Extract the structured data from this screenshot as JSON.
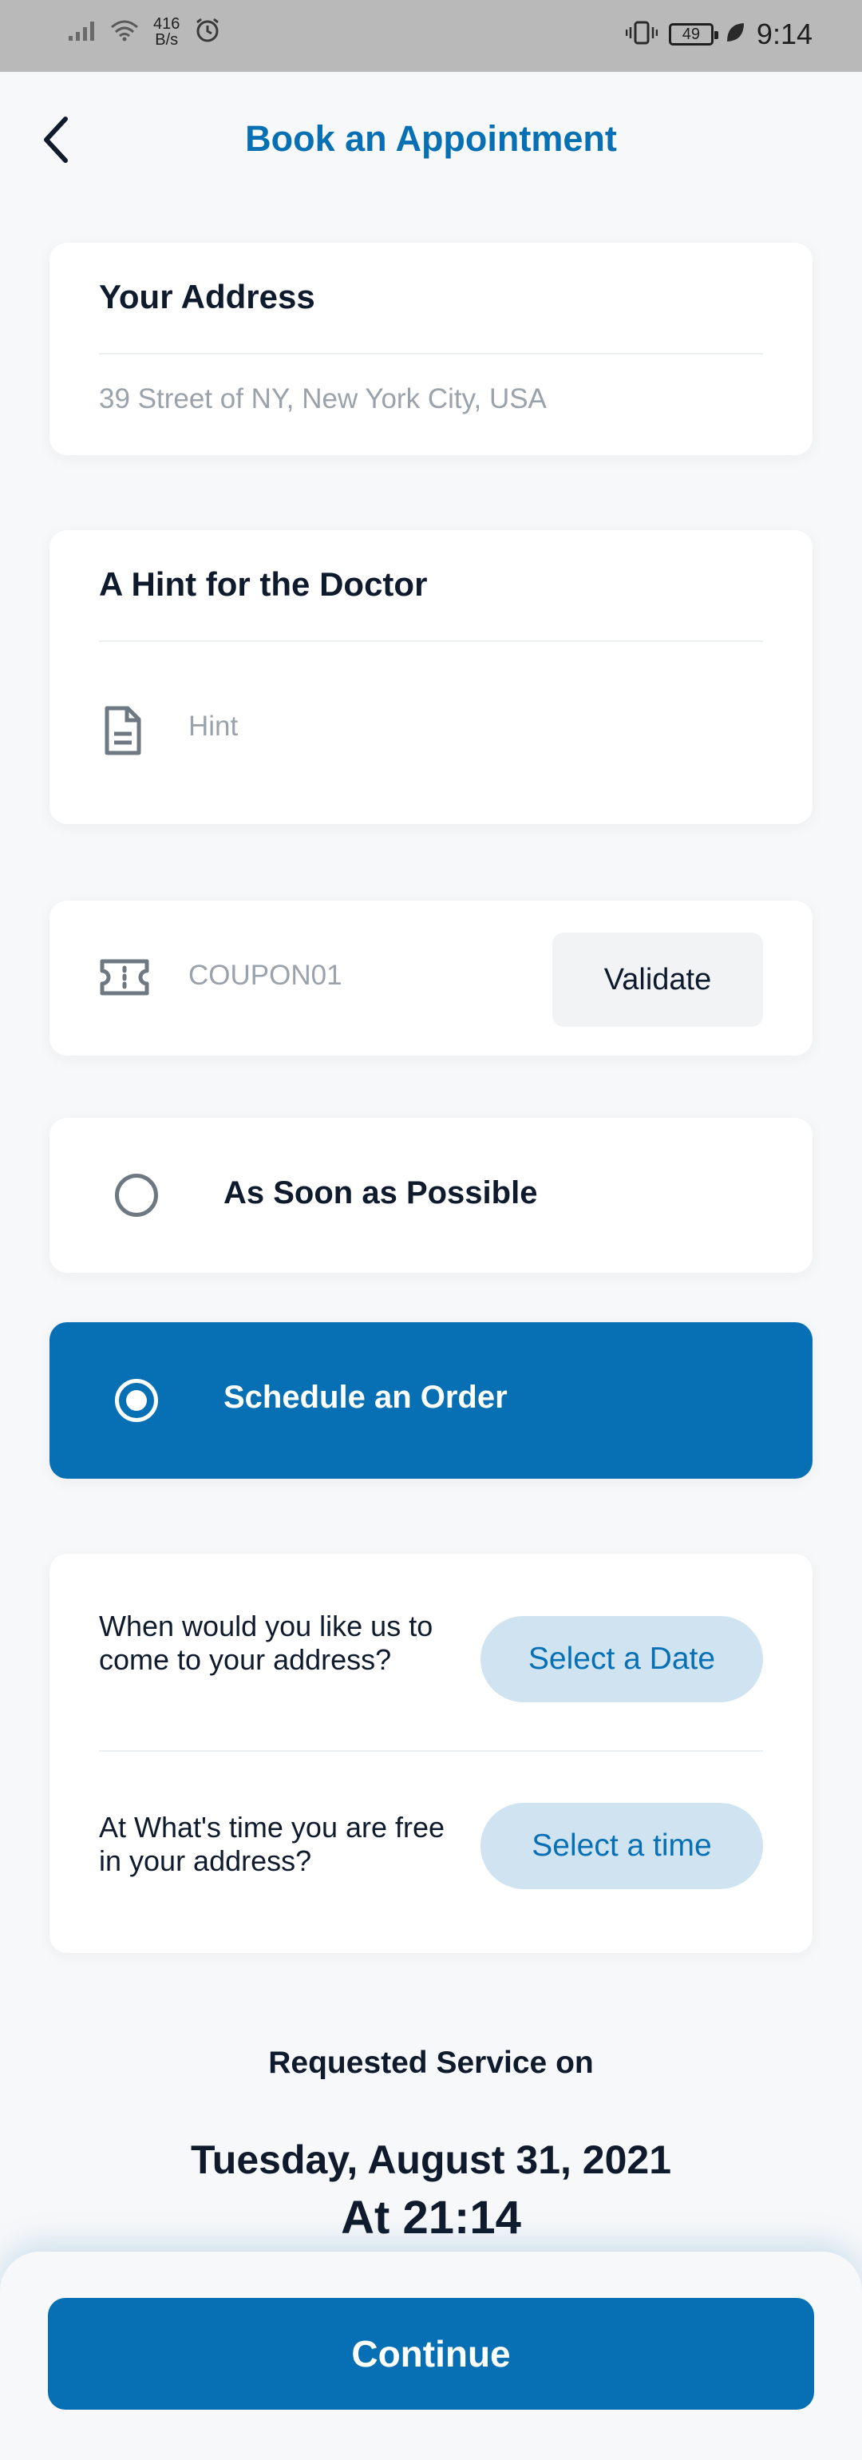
{
  "status_bar": {
    "net_speed_value": "416",
    "net_speed_unit": "B/s",
    "battery": "49",
    "time": "9:14"
  },
  "header": {
    "title": "Book an Appointment"
  },
  "address": {
    "title": "Your Address",
    "value": "39 Street of NY, New York City, USA"
  },
  "hint": {
    "title": "A Hint for the Doctor",
    "placeholder": "Hint"
  },
  "coupon": {
    "value": "COUPON01",
    "validate_label": "Validate"
  },
  "options": {
    "asap_label": "As Soon as Possible",
    "schedule_label": "Schedule an Order",
    "selected": "schedule"
  },
  "schedule": {
    "date_question": "When would you like us to come to your address?",
    "date_button": "Select a Date",
    "time_question": "At What's time you are free in your address?",
    "time_button": "Select a time"
  },
  "summary": {
    "requested_label": "Requested Service on",
    "date": "Tuesday, August 31, 2021",
    "time": "At 21:14"
  },
  "footer": {
    "continue_label": "Continue"
  },
  "colors": {
    "brand": "#0770b5",
    "background": "#f7f8f9",
    "pill_bg": "#cfe3f1"
  }
}
